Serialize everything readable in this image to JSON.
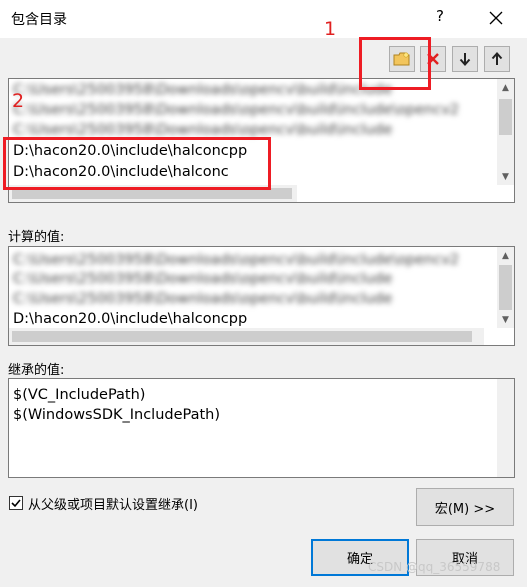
{
  "window": {
    "title": "包含目录",
    "help_label": "?",
    "close_icon": "close-icon"
  },
  "toolbar": {
    "new_line_icon": "new-folder-icon",
    "delete_icon": "delete-icon",
    "move_down_icon": "arrow-down-icon",
    "move_up_icon": "arrow-up-icon"
  },
  "directories": {
    "items": [
      "C:\\Users\\25003958\\Downloads\\opencv\\build\\include",
      "C:\\Users\\25003958\\Downloads\\opencv\\build\\include\\opencv2",
      "C:\\Users\\25003958\\Downloads\\opencv\\build\\include",
      "D:\\hacon20.0\\include\\halconcpp",
      "D:\\hacon20.0\\include\\halconc"
    ]
  },
  "computed": {
    "label": "计算的值:",
    "items": [
      "C:\\Users\\25003958\\Downloads\\opencv\\build\\include\\opencv2",
      "C:\\Users\\25003958\\Downloads\\opencv\\build\\include",
      "C:\\Users\\25003958\\Downloads\\opencv\\build\\include",
      "D:\\hacon20.0\\include\\halconcpp"
    ]
  },
  "inherited": {
    "label": "继承的值:",
    "items": [
      "$(VC_IncludePath)",
      "$(WindowsSDK_IncludePath)"
    ]
  },
  "inherit_checkbox": {
    "label": "从父级或项目默认设置继承(I)",
    "checked": true
  },
  "buttons": {
    "macro": "宏(M) >>",
    "ok": "确定",
    "cancel": "取消"
  },
  "annotations": {
    "marker1": "1",
    "marker2": "2",
    "color": "#ee1c24"
  },
  "watermark": "CSDN @qq_36559788"
}
